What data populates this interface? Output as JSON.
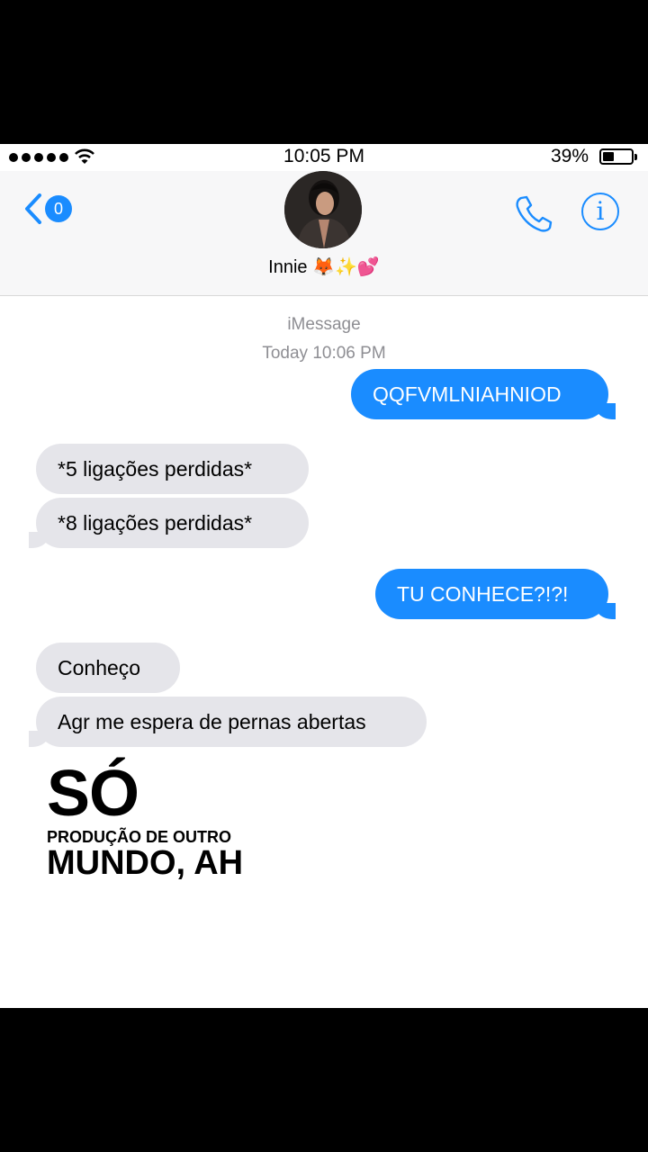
{
  "status_bar": {
    "time": "10:05 PM",
    "battery": "39%",
    "battery_level": 0.39
  },
  "header": {
    "back_count": "0",
    "contact_name": "Innie 🦊✨💕"
  },
  "thread": {
    "service": "iMessage",
    "timestamp": "Today 10:06 PM",
    "messages": [
      {
        "text": "QQFVMLNIAHNIOD",
        "direction": "sent"
      },
      {
        "text": "*5 ligações perdidas*",
        "direction": "received"
      },
      {
        "text": "*8 ligações perdidas*",
        "direction": "received"
      },
      {
        "text": "TU CONHECE?!?!",
        "direction": "sent"
      },
      {
        "text": "Conheço",
        "direction": "received"
      },
      {
        "text": "Agr me espera de pernas abertas",
        "direction": "received"
      }
    ]
  },
  "overlay": {
    "line1": "SÓ",
    "line2": "PRODUÇÃO DE OUTRO",
    "line3": "MUNDO, AH"
  },
  "colors": {
    "sent": "#1a8cff",
    "received": "#e5e5ea",
    "accent": "#1a8cff"
  },
  "icons": {
    "back": "chevron-left-icon",
    "call": "phone-icon",
    "info": "info-icon"
  }
}
